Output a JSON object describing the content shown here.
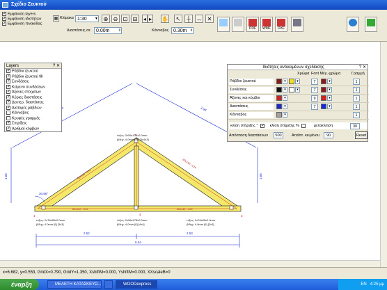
{
  "window": {
    "title": "Σχέδιο Ζευκτού"
  },
  "toolbar": {
    "checks": [
      "Εμφάνιση layers",
      "Εμφάνιση ιδιοτήτων",
      "Εμφάνιση πινακίδας"
    ],
    "scale_label": "Κλίμακα",
    "scale_value": "1:30",
    "dim_distance_label": "Διαστάσεις σε",
    "dim_distance_value": "0.00m",
    "grid_label": "Κάνναβος",
    "grid_value": "0.30m",
    "pdf_label": "PDF",
    "wmf_label": "WMF",
    "dxf_label": "DXF"
  },
  "layers": {
    "title": "Layers",
    "items": [
      "Ράβδοι ζευκτού",
      "Ράβδοι ζευκτού fill",
      "Συνδέσεις",
      "Κείμενο συνδέσεων",
      "Άξονες στοιχείων",
      "Κύριες διαστάσεις",
      "Δευτερ. διαστάσεις",
      "Διατομές ράβδων",
      "Κάνναβος",
      "Κρυφές γραμμές",
      "Στηρίξεις",
      "Αριθμοί κόμβων"
    ],
    "checked": [
      true,
      true,
      true,
      true,
      true,
      true,
      true,
      true,
      false,
      false,
      true,
      true
    ]
  },
  "properties": {
    "title": "Ιδιότητες αντικειμένων σχεδίασης",
    "col_color": "Χρώμα",
    "col_font": "Font Μέγ.-χρώμα",
    "col_line": "Γραμμή",
    "rows": [
      {
        "name": "Ράβδοι ζευκτού",
        "c1": "#8b1a1a",
        "c2": "#f0e020",
        "size": "7",
        "fc": "#8b1a1a",
        "line": "1"
      },
      {
        "name": "Συνδέσεις",
        "c1": "#111111",
        "c2": "#ffffff",
        "size": "7",
        "fc": "#8b1a1a",
        "line": "1"
      },
      {
        "name": "Άξονες και κόμβοι",
        "c1": "#d02020",
        "c2": "",
        "size": "9",
        "fc": "#d02020",
        "line": "1"
      },
      {
        "name": "Διαστάσεις",
        "c1": "#1a2ad0",
        "c2": "",
        "size": "7",
        "fc": "#1a2ad0",
        "line": "1"
      },
      {
        "name": "Κάνναβος",
        "c1": "#a0a0a0",
        "c2": "",
        "size": "",
        "fc": "",
        "line": "1"
      }
    ],
    "support_label": "κλίση στήριξης °",
    "support_pct_label": "κλίση στήριξης %",
    "shift_label": "μετακίνηση",
    "shift_value": "30",
    "dist_label": "Απόσταση διαστάσεων",
    "dist_value": "500",
    "text_label": "Απόστ. κειμένου",
    "text_value": "90",
    "reset_label": "Reset"
  },
  "drawing": {
    "apex_label_1": "τόξος: 2x56x178x2.0mm",
    "apex_label_2": "βίδηγ: 4.0mm [11] [3x4x3]",
    "left_label_1": "τόξος: 2x76x85x2.0mm",
    "left_label_2": "βίδηγ: 4.0mm [6] [3x3]",
    "mid_label_1": "τόξος: 2x56x178x2.0mm",
    "mid_label_2": "βίδηγ: 4.0mm [6] [4x4]",
    "right_label_1": "τόξος: 2x76x85x2.0mm",
    "right_label_2": "βίδηγ: 4.0mm [6] [3x3]",
    "angle": "30.96°",
    "dim_left_rafter": "2.94",
    "dim_right_rafter": "2.94",
    "dim_height_left": "1.66",
    "dim_height_right": "1.66",
    "dim_half_left": "2.52",
    "dim_half_right": "2.53",
    "dim_total": "5.04",
    "bar_left_rafter": "60x140 : C24",
    "bar_right_rafter": "60x140 : C24",
    "bar_left_chord": "60x140 : C24",
    "bar_right_chord": "60x140 : C24",
    "node1": "1",
    "node2": "2",
    "node3": "3",
    "node4": "4"
  },
  "status": {
    "text": "x=6.682, y=0.553, GridX=0.790, GridY=1.350, XshiftM=0.000, YshiftM=0.000, XXscaleB=0"
  },
  "taskbar": {
    "start": "έναρξη",
    "tasks": [
      "ΜΕΛΕΤΗ ΚΑΤΑΣΚΕΥΩ...",
      "",
      "WOODexpress"
    ],
    "lang": "EN",
    "time": "4:25 μμ"
  }
}
